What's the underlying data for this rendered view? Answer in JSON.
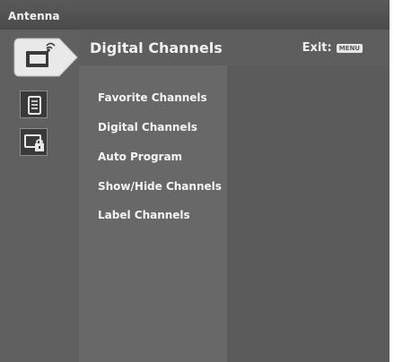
{
  "title_bar": {
    "title": "Antenna"
  },
  "header": {
    "title": "Digital Channels",
    "exit_label": "Exit:",
    "exit_key": "MENU"
  },
  "sidebar": {
    "icons": [
      {
        "name": "tv-antenna-icon",
        "active": true
      },
      {
        "name": "channel-list-icon",
        "active": false
      },
      {
        "name": "lock-screen-icon",
        "active": false
      }
    ]
  },
  "menu": {
    "items": [
      {
        "label": "Favorite Channels"
      },
      {
        "label": "Digital Channels"
      },
      {
        "label": "Auto Program"
      },
      {
        "label": "Show/Hide Channels"
      },
      {
        "label": "Label Channels"
      }
    ]
  },
  "colors": {
    "background": "#5f5f5f",
    "title_bar": "#4b4b4b",
    "text": "#f0f0f0",
    "selector": "#e8e8e8"
  }
}
